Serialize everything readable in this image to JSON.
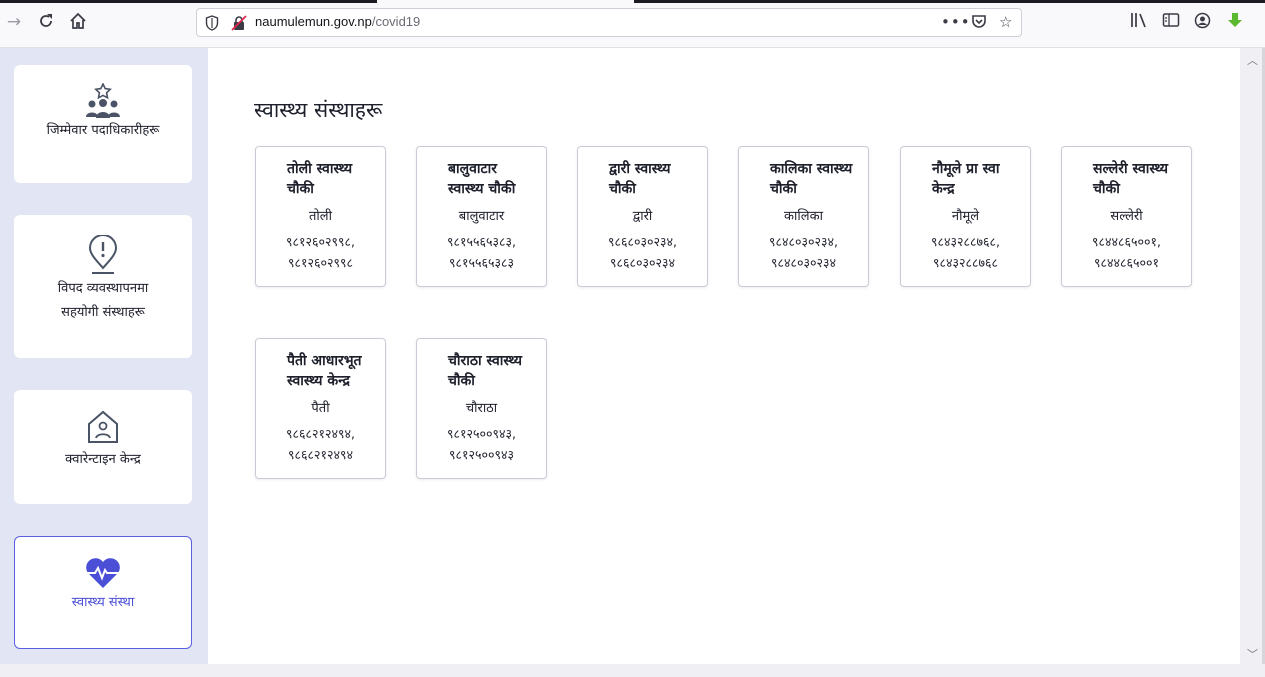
{
  "browser": {
    "url_host": "naumulemun.gov.np",
    "url_path": "/covid19",
    "icons": [
      "back-icon",
      "reload-icon",
      "home-icon",
      "shield-icon",
      "insecure-lock-icon",
      "more-icon",
      "pocket-icon",
      "bookmark-star-icon",
      "library-icon",
      "reader-icon",
      "account-icon",
      "download-icon"
    ]
  },
  "sidebar": {
    "items": [
      {
        "label": "जिम्मेवार पदाधिकारीहरू",
        "icon": "people-star-icon"
      },
      {
        "label_line1": "विपद व्यवस्थापनमा",
        "label_line2": "सहयोगी संस्थाहरू",
        "icon": "alert-pin-icon"
      },
      {
        "label": "क्वारेन्टाइन केन्द्र",
        "icon": "house-person-icon"
      },
      {
        "label": "स्वास्थ्य संस्था",
        "icon": "heart-pulse-icon",
        "active": true
      }
    ]
  },
  "main": {
    "title": "स्वास्थ्य संस्थाहरू",
    "cards": [
      {
        "name": "तोली स्वास्थ्य चौकी",
        "place": "तोली",
        "phone1": "९८१२६०२९९८,",
        "phone2": "९८१२६०२९९८"
      },
      {
        "name": "बालुवाटार स्वास्थ्य चौकी",
        "place": "बालुवाटार",
        "phone1": "९८१५५६५३८३,",
        "phone2": "९८१५५६५३८३"
      },
      {
        "name": "द्वारी स्वास्थ्य चौकी",
        "place": "द्वारी",
        "phone1": "९८६८०३०२३४,",
        "phone2": "९८६८०३०२३४"
      },
      {
        "name": "कालिका स्वास्थ्य चौकी",
        "place": "कालिका",
        "phone1": "९८४८०३०२३४,",
        "phone2": "९८४८०३०२३४"
      },
      {
        "name": "नौमूले प्रा स्वा केन्द्र",
        "place": "नौमूले",
        "phone1": "९८४३२८८७६८,",
        "phone2": "९८४३२८८७६८"
      },
      {
        "name": "सल्लेरी स्वास्थ्य चौकी",
        "place": "सल्लेरी",
        "phone1": "९८४४८६५००१,",
        "phone2": "९८४४८६५००१"
      },
      {
        "name": "पैती आधारभूत स्वास्थ्य केन्द्र",
        "place": "पैती",
        "phone1": "९८६८२१२४९४,",
        "phone2": "९८६८२१२४९४"
      },
      {
        "name": "चौराठा स्वास्थ्य चौकी",
        "place": "चौराठा",
        "phone1": "९८१२५००९४३,",
        "phone2": "९८१२५००९४३"
      }
    ]
  },
  "colors": {
    "accent": "#4b4fd6",
    "sidebar_bg": "#e2e6f4",
    "icon_dark": "#4a5466"
  }
}
